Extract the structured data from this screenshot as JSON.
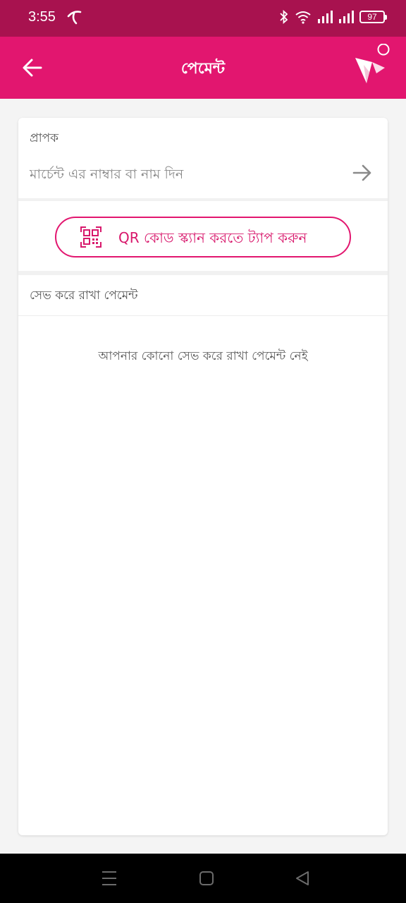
{
  "status_bar": {
    "time": "3:55",
    "battery": "97",
    "icons": [
      "carrier-icon",
      "bluetooth-icon",
      "wifi-icon",
      "signal-icon",
      "signal-icon",
      "battery-icon"
    ]
  },
  "app_bar": {
    "title": "পেমেন্ট",
    "back_icon": "arrow-left-icon",
    "logo": "bird-logo"
  },
  "recipient": {
    "label": "প্রাপক",
    "placeholder": "মার্চেন্ট এর নাম্বার বা নাম দিন",
    "go_icon": "arrow-right-icon"
  },
  "qr": {
    "label": "QR কোড স্ক্যান করতে ট্যাপ করুন",
    "icon": "qr-code-icon"
  },
  "saved": {
    "title": "সেভ করে রাখা পেমেন্ট",
    "empty_message": "আপনার কোনো সেভ করে রাখা পেমেন্ট নেই"
  },
  "colors": {
    "status_bar": "#a8124f",
    "app_bar": "#e2166f",
    "accent": "#d8186c",
    "background": "#f4f4f4"
  }
}
